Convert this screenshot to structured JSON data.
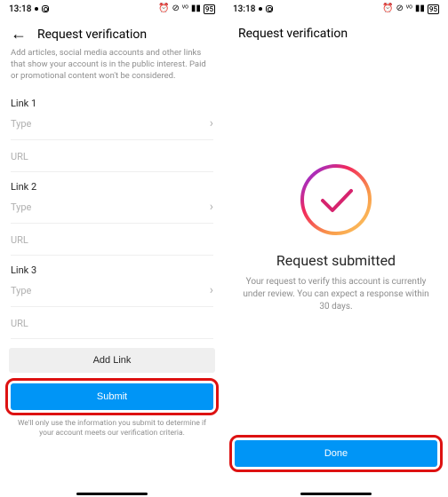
{
  "status": {
    "time": "13:18",
    "battery": "95"
  },
  "left": {
    "title": "Request verification",
    "helper": "Add articles, social media accounts and other links that show your account is in the public interest. Paid or promotional content won't be considered.",
    "link1_label": "Link 1",
    "link2_label": "Link 2",
    "link3_label": "Link 3",
    "type_placeholder": "Type",
    "url_label": "URL",
    "add_link": "Add Link",
    "submit": "Submit",
    "footnote": "We'll only use the information you submit to determine if your account meets our verification criteria."
  },
  "right": {
    "title": "Request verification",
    "submitted_title": "Request submitted",
    "submitted_text": "Your request to verify this account is currently under review. You can expect a response within 30 days.",
    "done": "Done"
  }
}
